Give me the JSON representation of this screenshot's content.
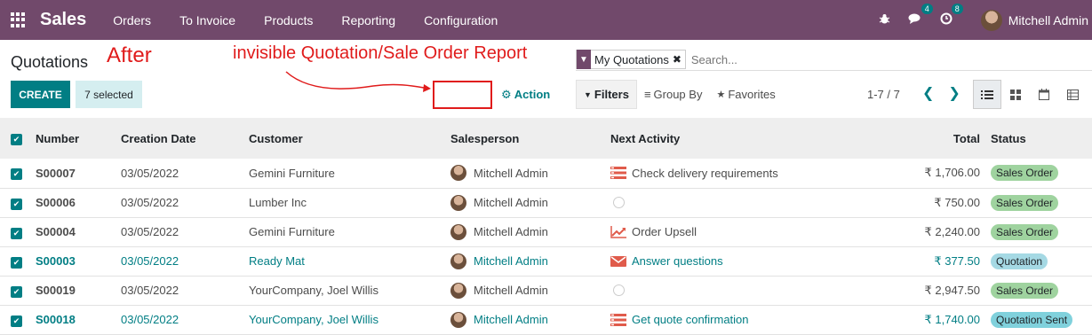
{
  "navbar": {
    "brand": "Sales",
    "menu": [
      "Orders",
      "To Invoice",
      "Products",
      "Reporting",
      "Configuration"
    ],
    "chat_badge": "4",
    "activity_badge": "8",
    "user": "Mitchell Admin"
  },
  "control": {
    "title": "Quotations",
    "annotation_after": "After",
    "annotation_text": "invisible Quotation/Sale Order Report",
    "create_label": "CREATE",
    "selected_label": "7 selected",
    "action_label": "Action",
    "facet_label": "My Quotations",
    "search_placeholder": "Search...",
    "filters_label": "Filters",
    "groupby_label": "Group By",
    "favorites_label": "Favorites",
    "pager": "1-7 / 7",
    "colors": {
      "accent": "#017e84",
      "navbar": "#71496b",
      "annotation": "#e01b1b"
    }
  },
  "table": {
    "headers": [
      "Number",
      "Creation Date",
      "Customer",
      "Salesperson",
      "Next Activity",
      "Total",
      "Status"
    ],
    "rows": [
      {
        "number": "S00007",
        "date": "03/05/2022",
        "customer": "Gemini Furniture",
        "salesperson": "Mitchell Admin",
        "activity": "Check delivery requirements",
        "activity_icon": "checklist-icon",
        "total": "₹ 1,706.00",
        "status": "Sales Order"
      },
      {
        "number": "S00006",
        "date": "03/05/2022",
        "customer": "Lumber Inc",
        "salesperson": "Mitchell Admin",
        "activity": "",
        "activity_icon": "clock-icon",
        "total": "₹ 750.00",
        "status": "Sales Order"
      },
      {
        "number": "S00004",
        "date": "03/05/2022",
        "customer": "Gemini Furniture",
        "salesperson": "Mitchell Admin",
        "activity": "Order Upsell",
        "activity_icon": "chart-line-icon",
        "total": "₹ 2,240.00",
        "status": "Sales Order"
      },
      {
        "number": "S00003",
        "date": "03/05/2022",
        "customer": "Ready Mat",
        "salesperson": "Mitchell Admin",
        "activity": "Answer questions",
        "activity_icon": "envelope-icon",
        "total": "₹ 377.50",
        "status": "Quotation"
      },
      {
        "number": "S00019",
        "date": "03/05/2022",
        "customer": "YourCompany, Joel Willis",
        "salesperson": "Mitchell Admin",
        "activity": "",
        "activity_icon": "clock-icon",
        "total": "₹ 2,947.50",
        "status": "Sales Order"
      },
      {
        "number": "S00018",
        "date": "03/05/2022",
        "customer": "YourCompany, Joel Willis",
        "salesperson": "Mitchell Admin",
        "activity": "Get quote confirmation",
        "activity_icon": "checklist-icon",
        "total": "₹ 1,740.00",
        "status": "Quotation Sent"
      }
    ]
  }
}
